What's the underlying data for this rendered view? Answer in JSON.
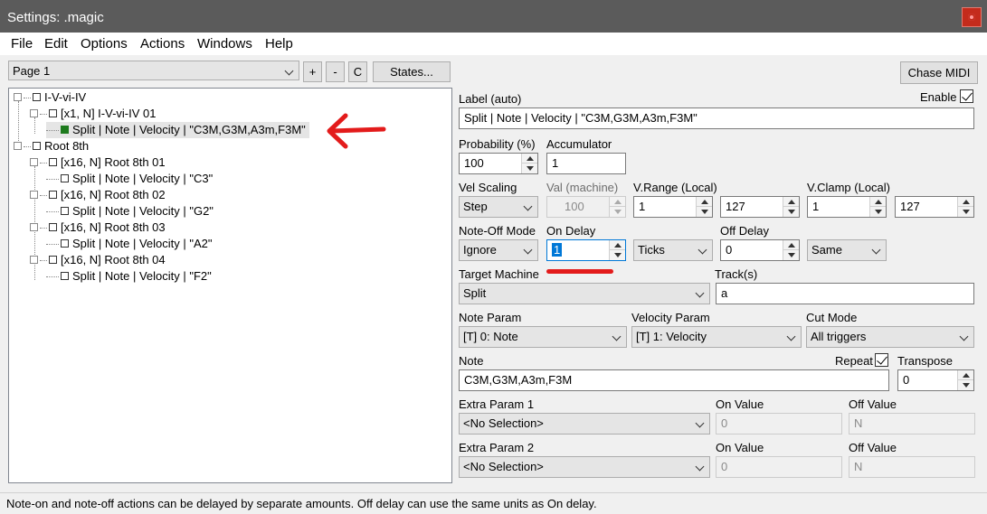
{
  "window": {
    "title": "Settings: .magic"
  },
  "menu": [
    "File",
    "Edit",
    "Options",
    "Actions",
    "Windows",
    "Help"
  ],
  "toolbar": {
    "page_select": "Page 1",
    "plus": "+",
    "minus": "-",
    "c": "C",
    "states": "States...",
    "chase_midi": "Chase MIDI"
  },
  "tree": [
    "I-V-vi-IV",
    "[x1, N] I-V-vi-IV 01",
    "Split | Note | Velocity | \"C3M,G3M,A3m,F3M\"",
    "Root 8th",
    "[x16, N] Root 8th 01",
    "Split | Note | Velocity | \"C3\"",
    "[x16, N] Root 8th 02",
    "Split | Note | Velocity | \"G2\"",
    "[x16, N] Root 8th 03",
    "Split | Note | Velocity | \"A2\"",
    "[x16, N] Root 8th 04",
    "Split | Note | Velocity | \"F2\""
  ],
  "form": {
    "label_caption": "Label (auto)",
    "enable_label": "Enable",
    "label_value": "Split | Note | Velocity | \"C3M,G3M,A3m,F3M\"",
    "probability_label": "Probability (%)",
    "probability_value": "100",
    "accumulator_label": "Accumulator",
    "accumulator_value": "1",
    "vel_scaling_label": "Vel Scaling",
    "vel_scaling_value": "Step",
    "val_machine_label": "Val (machine)",
    "val_machine_value": "100",
    "vrange_label": "V.Range (Local)",
    "vrange_min": "1",
    "vrange_max": "127",
    "vclamp_label": "V.Clamp (Local)",
    "vclamp_min": "1",
    "vclamp_max": "127",
    "noteoff_mode_label": "Note-Off Mode",
    "noteoff_mode_value": "Ignore",
    "on_delay_label": "On Delay",
    "on_delay_value": "1",
    "on_delay_units": "Ticks",
    "off_delay_label": "Off Delay",
    "off_delay_value": "0",
    "off_delay_units": "Same",
    "target_machine_label": "Target Machine",
    "target_machine_value": "Split",
    "tracks_label": "Track(s)",
    "tracks_value": "a",
    "note_param_label": "Note Param",
    "note_param_value": "[T] 0: Note",
    "velocity_param_label": "Velocity Param",
    "velocity_param_value": "[T] 1: Velocity",
    "cut_mode_label": "Cut Mode",
    "cut_mode_value": "All triggers",
    "note_label": "Note",
    "note_value": "C3M,G3M,A3m,F3M",
    "repeat_label": "Repeat",
    "transpose_label": "Transpose",
    "transpose_value": "0",
    "extra1_label": "Extra Param 1",
    "extra1_value": "<No Selection>",
    "extra1_on_label": "On Value",
    "extra1_on_value": "0",
    "extra1_off_label": "Off Value",
    "extra1_off_value": "N",
    "extra2_label": "Extra Param 2",
    "extra2_value": "<No Selection>",
    "extra2_on_label": "On Value",
    "extra2_on_value": "0",
    "extra2_off_label": "Off Value",
    "extra2_off_value": "N"
  },
  "status": "Note-on and note-off actions can be delayed by separate amounts. Off delay can use the same units as On delay.",
  "colors": {
    "annotation": "#e31b1b",
    "active_node": "#1e7b1e",
    "titlebar": "#5b5b5b",
    "close_button": "#c42b1c"
  }
}
